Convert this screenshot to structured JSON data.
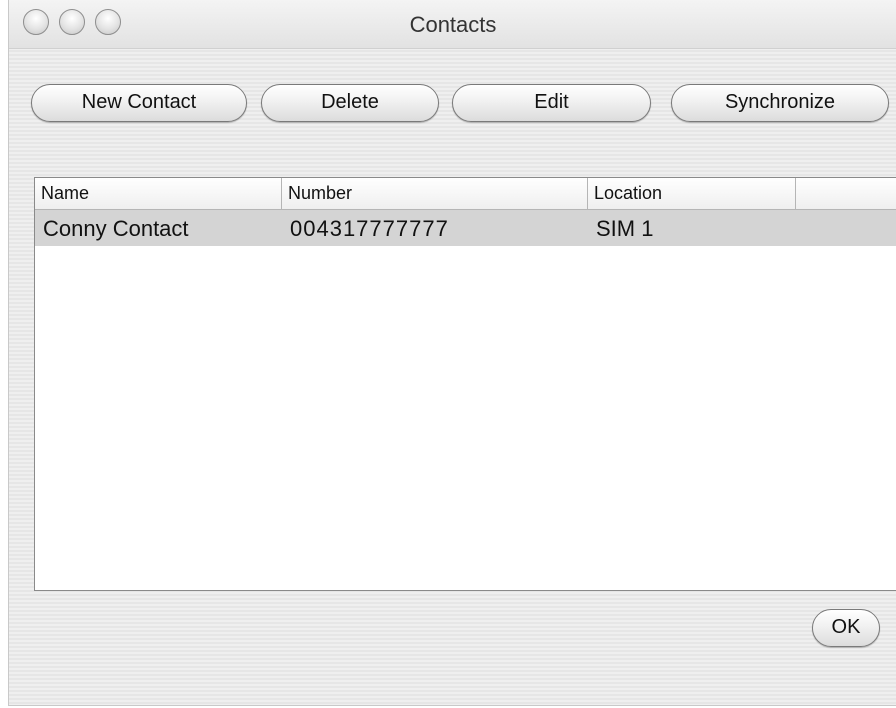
{
  "window": {
    "title": "Contacts"
  },
  "toolbar": {
    "new_contact_label": "New Contact",
    "delete_label": "Delete",
    "edit_label": "Edit",
    "synchronize_label": "Synchronize"
  },
  "table": {
    "columns": [
      "Name",
      "Number",
      "Location",
      ""
    ],
    "rows": [
      {
        "name": "Conny Contact",
        "number": "004317777777",
        "location": "SIM 1",
        "selected": true
      }
    ]
  },
  "footer": {
    "ok_label": "OK"
  },
  "colors": {
    "selected_row": "#d4d4d4",
    "window_background": "#ececec"
  }
}
